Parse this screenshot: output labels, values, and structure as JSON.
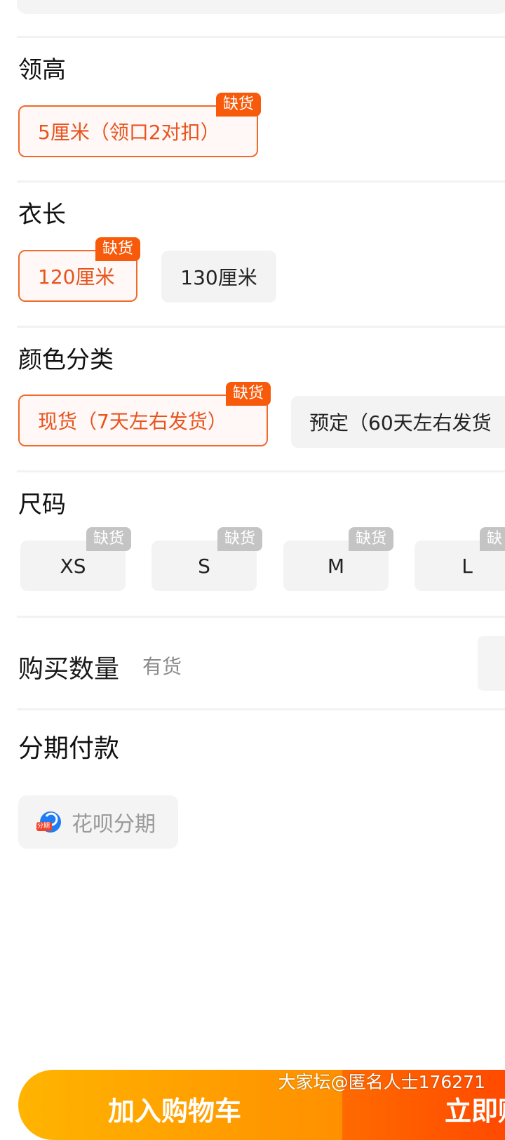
{
  "colors": {
    "accent": "#f06a2b",
    "badge_orange": "#f75a0a",
    "badge_gray": "#c4c4c4",
    "cart_button": "#ff9f00",
    "buy_button": "#ff5500"
  },
  "collar": {
    "title": "领高",
    "options": [
      {
        "label": "5厘米（领口2对扣）",
        "badge": "缺货",
        "selected": true
      }
    ]
  },
  "length": {
    "title": "衣长",
    "options": [
      {
        "label": "120厘米",
        "badge": "缺货",
        "selected": true
      },
      {
        "label": "130厘米",
        "selected": false
      }
    ]
  },
  "color": {
    "title": "颜色分类",
    "options": [
      {
        "label": "现货（7天左右发货）",
        "badge": "缺货",
        "selected": true
      },
      {
        "label": "预定（60天左右发货",
        "selected": false
      }
    ]
  },
  "size": {
    "title": "尺码",
    "options": [
      {
        "label": "XS",
        "badge": "缺货"
      },
      {
        "label": "S",
        "badge": "缺货"
      },
      {
        "label": "M",
        "badge": "缺货"
      },
      {
        "label": "L",
        "badge": "缺"
      }
    ]
  },
  "quantity": {
    "label": "购买数量",
    "stock": "有货"
  },
  "installment": {
    "title": "分期付款",
    "option": "花呗分期",
    "icon_text": "分期",
    "icon": "huabei-icon"
  },
  "actions": {
    "add_to_cart": "加入购物车",
    "buy_now": "立即购买"
  },
  "watermark": "大家坛@匿名人士176271"
}
